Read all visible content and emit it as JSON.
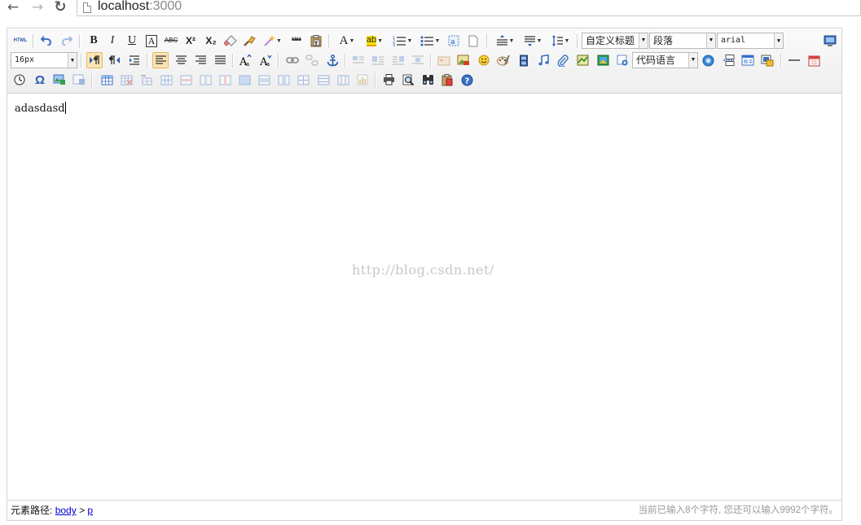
{
  "browser": {
    "back_icon": "←",
    "forward_icon": "→",
    "reload_icon": "↻",
    "url_host": "localhost",
    "url_port": ":3000"
  },
  "toolbar": {
    "row1": {
      "html_label": "HTML",
      "bold": "B",
      "italic": "I",
      "underline": "U",
      "fontborder": "A",
      "strikethrough": "ABC",
      "superscript": "X²",
      "subscript": "X₂",
      "blockquote": "❝❝",
      "forecolor": "A",
      "backcolor": "ab",
      "customstyle": "自定义标题",
      "paragraph": "段落",
      "fontfamily": "arial"
    },
    "row2": {
      "fontsize": "16px",
      "code_language": "代码语言",
      "omega": "Ω"
    }
  },
  "content": {
    "text": "adasdasd",
    "watermark": "http://blog.csdn.net/"
  },
  "statusbar": {
    "path_label": "元素路径:",
    "path_body": "body",
    "path_sep": ">",
    "path_p": "p",
    "wordcount": "当前已输入8个字符, 您还可以输入9992个字符。"
  }
}
